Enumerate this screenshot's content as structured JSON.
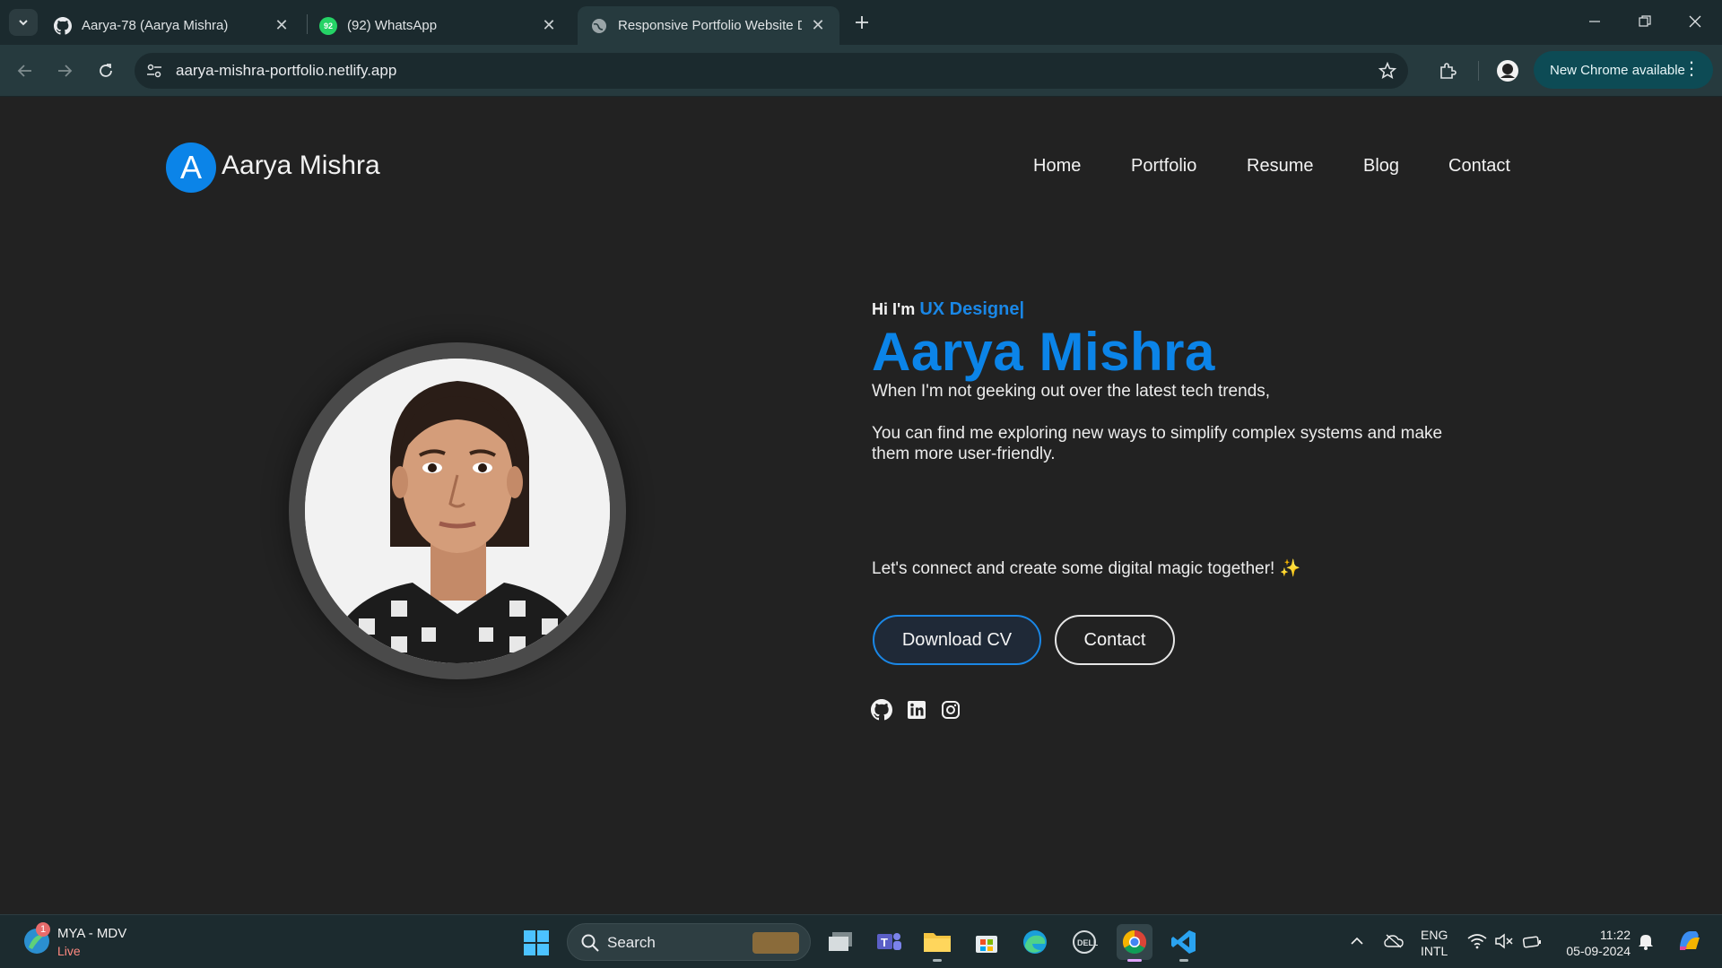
{
  "browser": {
    "tabs": [
      {
        "title": "Aarya-78 (Aarya Mishra)",
        "icon": "github-icon"
      },
      {
        "title": "(92) WhatsApp",
        "icon": "whatsapp-icon",
        "badge": "92"
      },
      {
        "title": "Responsive Portfolio Website De",
        "icon": "globe-icon"
      }
    ],
    "url": "aarya-mishra-portfolio.netlify.app",
    "update_button": "New Chrome available"
  },
  "site": {
    "logo_letter": "A",
    "logo_name": "Aarya Mishra",
    "nav": [
      "Home",
      "Portfolio",
      "Resume",
      "Blog",
      "Contact"
    ],
    "hero": {
      "greeting": "Hi I'm",
      "role": "UX Designe|",
      "name": "Aarya Mishra",
      "line1": "When I'm not geeking out over the latest tech trends,",
      "line2": "You can find me exploring new ways to simplify complex systems and make them more user-friendly.",
      "line3": "Let's connect and create some digital magic together! ✨",
      "download_cv": "Download CV",
      "contact": "Contact",
      "social": [
        "github-icon",
        "linkedin-icon",
        "instagram-icon"
      ]
    },
    "colors": {
      "accent": "#0b84e8",
      "background": "#222222"
    }
  },
  "taskbar": {
    "weather_title": "MYA - MDV",
    "weather_sub": "Live",
    "notification_count": "1",
    "search_label": "Search",
    "lang_top": "ENG",
    "lang_bottom": "INTL",
    "time": "11:22",
    "date": "05-09-2024"
  }
}
